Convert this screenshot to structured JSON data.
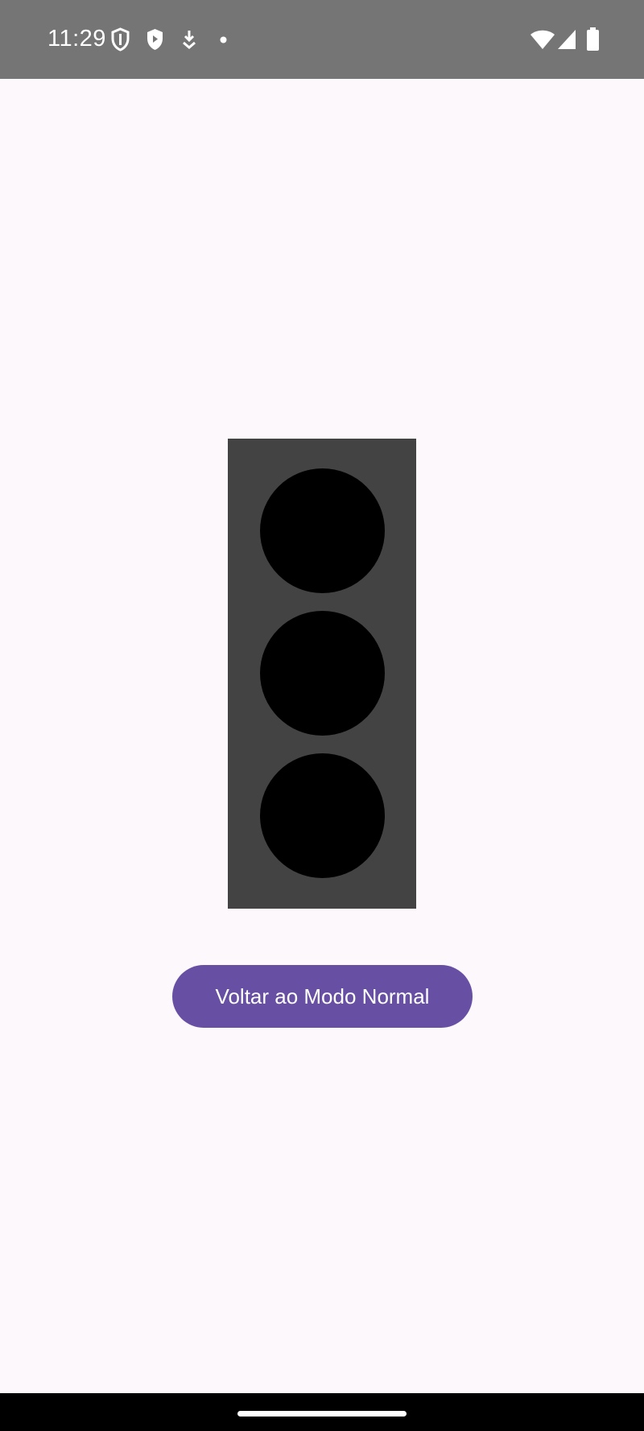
{
  "status_bar": {
    "time": "11:29",
    "left_icons": [
      "shield-outline-icon",
      "shield-filled-icon",
      "download-arrow-icon",
      "notification-dot-icon"
    ],
    "right_icons": [
      "wifi-icon",
      "cell-signal-icon",
      "battery-icon"
    ]
  },
  "traffic_light": {
    "housing_color": "#444344",
    "lamps": [
      {
        "name": "red",
        "color": "#000000",
        "on": false
      },
      {
        "name": "yellow",
        "color": "#000000",
        "on": false
      },
      {
        "name": "green",
        "color": "#000000",
        "on": false
      }
    ]
  },
  "actions": {
    "normal_mode_button": "Voltar ao Modo Normal"
  },
  "colors": {
    "background": "#FDF8FC",
    "status_bar": "#757575",
    "button": "#6750A4",
    "button_text": "#FFFFFF"
  }
}
